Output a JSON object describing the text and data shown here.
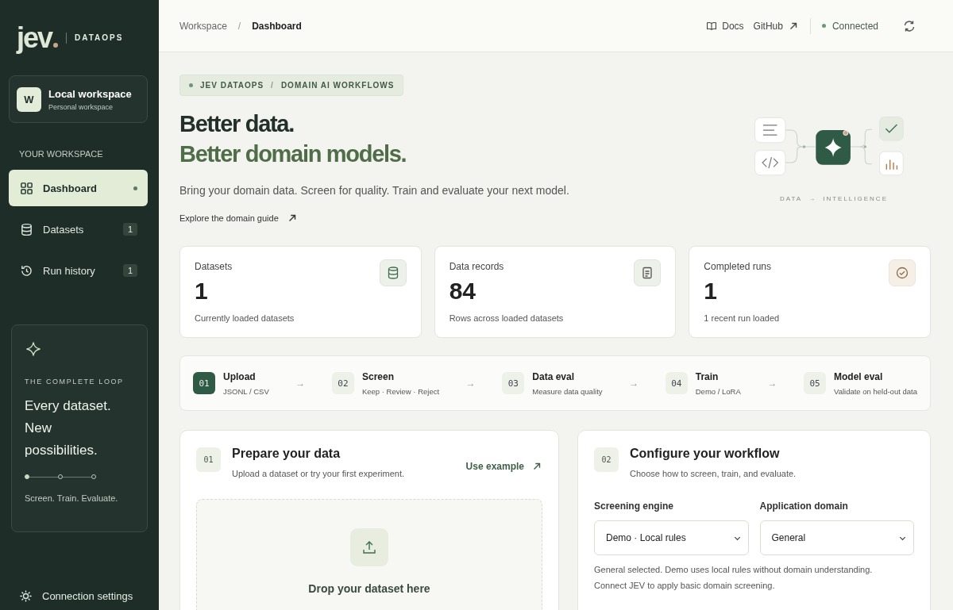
{
  "sidebar": {
    "logo": "jev",
    "product": "DATAOPS",
    "workspace": {
      "initial": "W",
      "name": "Local workspace",
      "subtitle": "Personal workspace"
    },
    "section_label": "YOUR WORKSPACE",
    "nav": [
      {
        "label": "Dashboard",
        "selected": true
      },
      {
        "label": "Datasets",
        "badge": "1",
        "selected": false
      },
      {
        "label": "Run history",
        "badge": "1",
        "selected": false
      }
    ],
    "loop_card": {
      "eyebrow": "THE COMPLETE LOOP",
      "lines": [
        "Every dataset.",
        "New",
        "possibilities."
      ],
      "progress": [
        {
          "done": true
        },
        {
          "done": false
        },
        {
          "done": false
        }
      ],
      "caption": "Screen. Train. Evaluate."
    },
    "footer_link": "Connection settings"
  },
  "header": {
    "breadcrumb": [
      "Workspace",
      "Dashboard"
    ],
    "separator": "/",
    "links": [
      "Docs",
      "GitHub"
    ],
    "status": "Connected"
  },
  "hero": {
    "tag": [
      "JEV DATAOPS",
      "DOMAIN AI WORKFLOWS"
    ],
    "tag_separator": "/",
    "title": "Better data.",
    "title_accent": "Better domain models.",
    "subtitle": "Bring your domain data. Screen for quality. Train and evaluate your next model.",
    "link": "Explore the domain guide",
    "diagram_caption": [
      "DATA",
      "→",
      "INTELLIGENCE"
    ]
  },
  "stats": [
    {
      "label": "Datasets",
      "value": "1",
      "note": "Currently loaded datasets"
    },
    {
      "label": "Data records",
      "value": "84",
      "note": "Rows across loaded datasets"
    },
    {
      "label": "Completed runs",
      "value": "1",
      "note": "1 recent run loaded"
    }
  ],
  "steps": [
    {
      "number": "01",
      "title": "Upload",
      "subtitle": "JSONL / CSV",
      "selected": true
    },
    {
      "number": "02",
      "title": "Screen",
      "subtitle": "Keep · Review · Reject",
      "selected": false
    },
    {
      "number": "03",
      "title": "Data eval",
      "subtitle": "Measure data quality",
      "selected": false
    },
    {
      "number": "04",
      "title": "Train",
      "subtitle": "Demo / LoRA",
      "selected": false
    },
    {
      "number": "05",
      "title": "Model eval",
      "subtitle": "Validate on held-out data",
      "selected": false
    }
  ],
  "step_arrow": "→",
  "prepare": {
    "number": "01",
    "title": "Prepare your data",
    "subtitle": "Upload a dataset or try your first experiment.",
    "action": "Use example",
    "dropzone": "Drop your dataset here"
  },
  "configure": {
    "number": "02",
    "title": "Configure your workflow",
    "subtitle": "Choose how to screen, train, and evaluate.",
    "fields": [
      {
        "label": "Screening engine",
        "value": "Demo · Local rules"
      },
      {
        "label": "Application domain",
        "value": "General"
      }
    ],
    "notes": [
      "General selected. Demo uses local rules without domain understanding.",
      "Connect JEV to apply basic domain screening."
    ]
  }
}
